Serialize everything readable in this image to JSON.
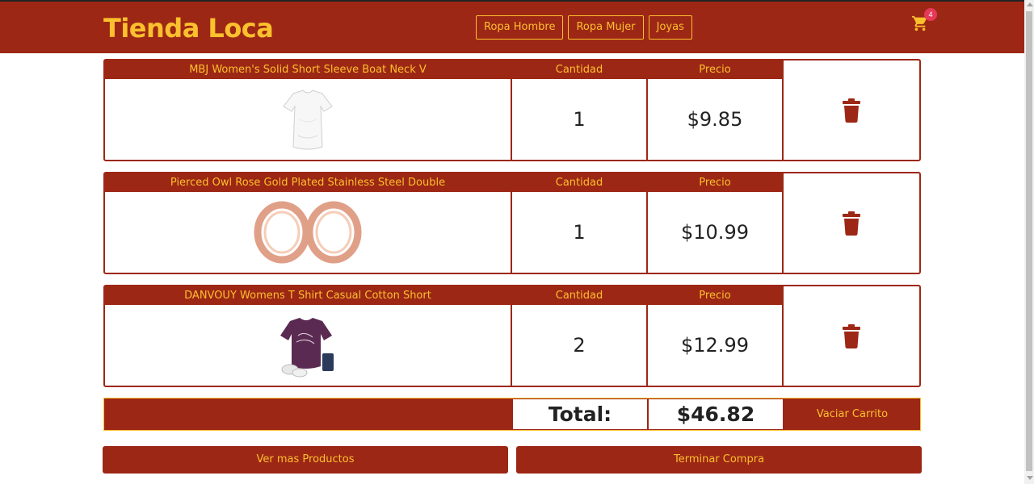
{
  "header": {
    "brand": "Tienda Loca",
    "nav": [
      "Ropa Hombre",
      "Ropa Mujer",
      "Joyas"
    ],
    "cart_count": "4"
  },
  "cart": {
    "qty_header": "Cantidad",
    "price_header": "Precio",
    "items": [
      {
        "name": "MBJ Women's Solid Short Sleeve Boat Neck V",
        "quantity": "1",
        "price": "$9.85",
        "image": "white-tshirt"
      },
      {
        "name": "Pierced Owl Rose Gold Plated Stainless Steel Double",
        "quantity": "1",
        "price": "$10.99",
        "image": "rose-gold-plugs"
      },
      {
        "name": "DANVOUY Womens T Shirt Casual Cotton Short",
        "quantity": "2",
        "price": "$12.99",
        "image": "purple-tshirt"
      }
    ],
    "total_label": "Total:",
    "total_value": "$46.82",
    "empty_label": "Vaciar Carrito"
  },
  "actions": {
    "more_products": "Ver mas Productos",
    "checkout": "Terminar Compra"
  },
  "colors": {
    "primary": "#9d2715",
    "accent": "#fbc02d",
    "badge": "#e53958"
  }
}
